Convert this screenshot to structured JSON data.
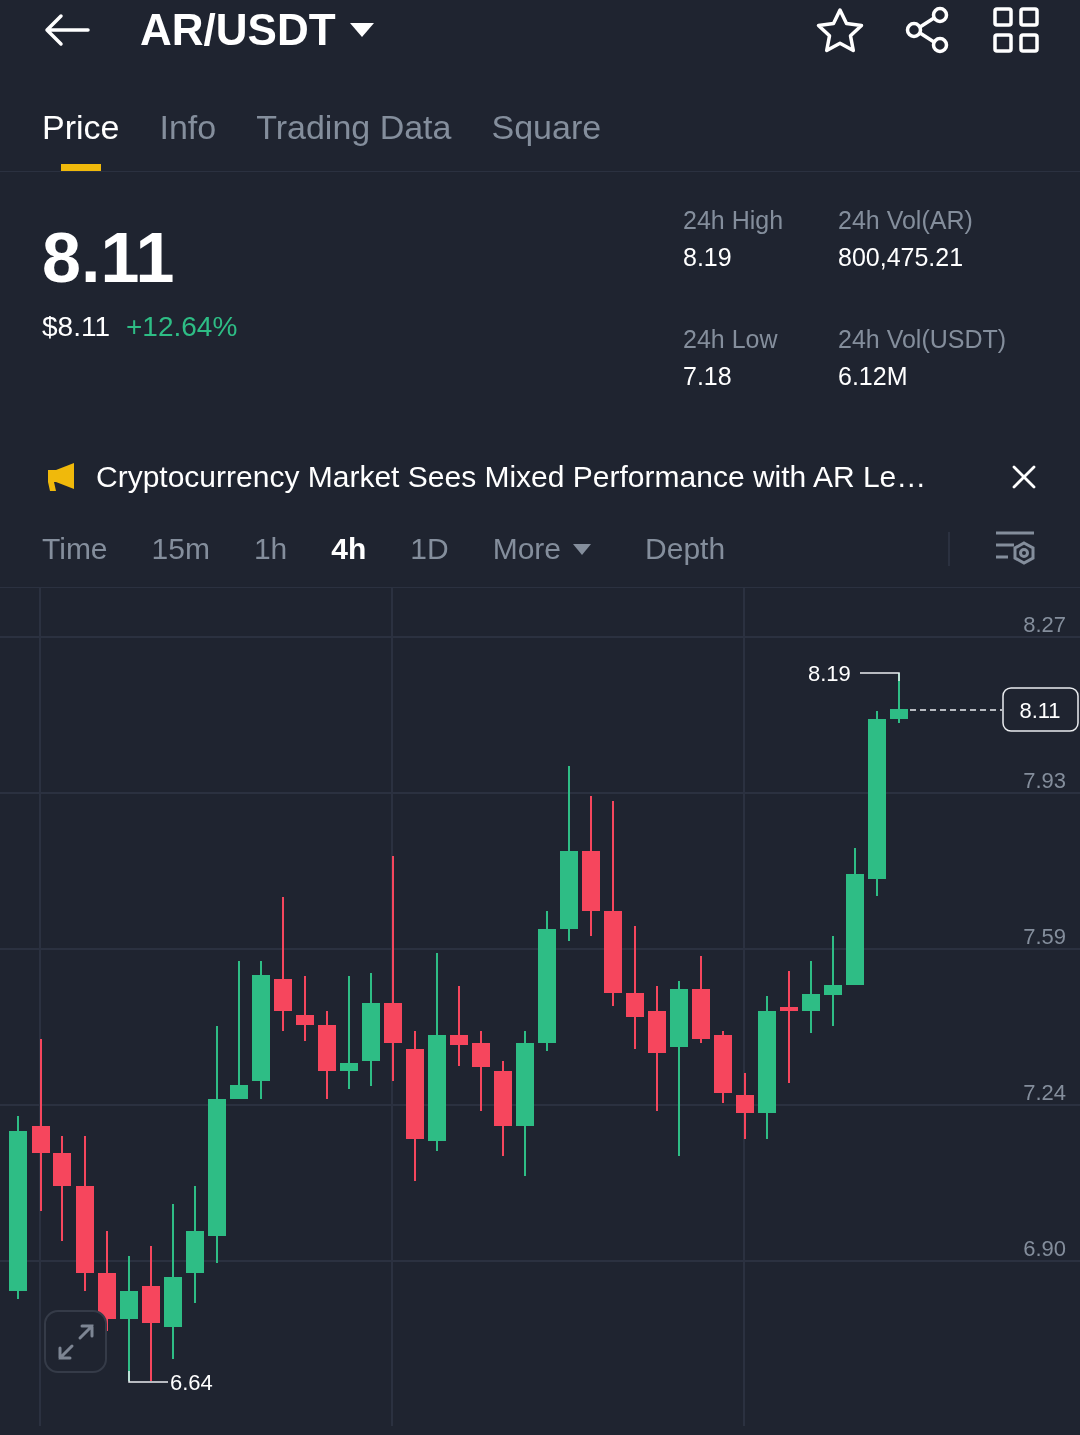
{
  "header": {
    "pair": "AR/USDT"
  },
  "tabs": [
    {
      "label": "Price",
      "selected": true
    },
    {
      "label": "Info",
      "selected": false
    },
    {
      "label": "Trading Data",
      "selected": false
    },
    {
      "label": "Square",
      "selected": false
    }
  ],
  "price": {
    "last": "8.11",
    "fiat": "$8.11",
    "change": "+12.64%"
  },
  "stats": [
    {
      "label": "24h High",
      "value": "8.19"
    },
    {
      "label": "24h Vol(AR)",
      "value": "800,475.21"
    },
    {
      "label": "24h Low",
      "value": "7.18"
    },
    {
      "label": "24h Vol(USDT)",
      "value": "6.12M"
    }
  ],
  "news_banner": {
    "text": "Cryptocurrency Market Sees Mixed Performance with AR Le…"
  },
  "intervals": [
    {
      "label": "Time",
      "selected": false
    },
    {
      "label": "15m",
      "selected": false
    },
    {
      "label": "1h",
      "selected": false
    },
    {
      "label": "4h",
      "selected": true
    },
    {
      "label": "1D",
      "selected": false
    },
    {
      "label": "More",
      "selected": false,
      "dropdown": true
    },
    {
      "label": "Depth",
      "selected": false
    }
  ],
  "chart": {
    "price_axis": [
      "8.27",
      "7.93",
      "7.59",
      "7.24",
      "6.90"
    ],
    "high_label": "8.19",
    "current_price": "8.11",
    "low_label": "6.64"
  }
}
